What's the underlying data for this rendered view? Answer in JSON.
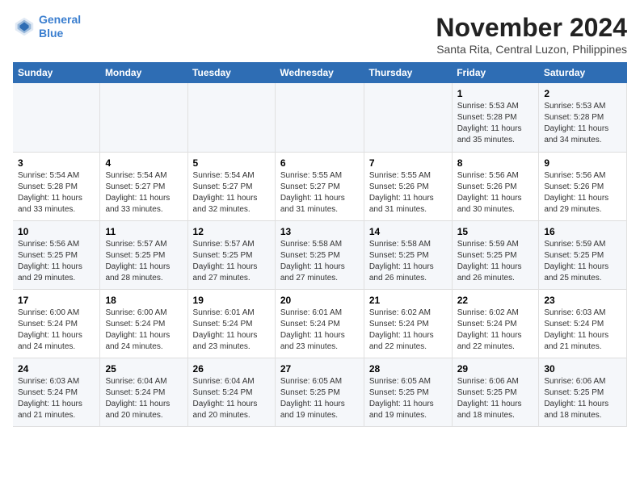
{
  "logo": {
    "line1": "General",
    "line2": "Blue"
  },
  "title": "November 2024",
  "subtitle": "Santa Rita, Central Luzon, Philippines",
  "days_header": [
    "Sunday",
    "Monday",
    "Tuesday",
    "Wednesday",
    "Thursday",
    "Friday",
    "Saturday"
  ],
  "weeks": [
    [
      {
        "day": "",
        "info": ""
      },
      {
        "day": "",
        "info": ""
      },
      {
        "day": "",
        "info": ""
      },
      {
        "day": "",
        "info": ""
      },
      {
        "day": "",
        "info": ""
      },
      {
        "day": "1",
        "info": "Sunrise: 5:53 AM\nSunset: 5:28 PM\nDaylight: 11 hours and 35 minutes."
      },
      {
        "day": "2",
        "info": "Sunrise: 5:53 AM\nSunset: 5:28 PM\nDaylight: 11 hours and 34 minutes."
      }
    ],
    [
      {
        "day": "3",
        "info": "Sunrise: 5:54 AM\nSunset: 5:28 PM\nDaylight: 11 hours and 33 minutes."
      },
      {
        "day": "4",
        "info": "Sunrise: 5:54 AM\nSunset: 5:27 PM\nDaylight: 11 hours and 33 minutes."
      },
      {
        "day": "5",
        "info": "Sunrise: 5:54 AM\nSunset: 5:27 PM\nDaylight: 11 hours and 32 minutes."
      },
      {
        "day": "6",
        "info": "Sunrise: 5:55 AM\nSunset: 5:27 PM\nDaylight: 11 hours and 31 minutes."
      },
      {
        "day": "7",
        "info": "Sunrise: 5:55 AM\nSunset: 5:26 PM\nDaylight: 11 hours and 31 minutes."
      },
      {
        "day": "8",
        "info": "Sunrise: 5:56 AM\nSunset: 5:26 PM\nDaylight: 11 hours and 30 minutes."
      },
      {
        "day": "9",
        "info": "Sunrise: 5:56 AM\nSunset: 5:26 PM\nDaylight: 11 hours and 29 minutes."
      }
    ],
    [
      {
        "day": "10",
        "info": "Sunrise: 5:56 AM\nSunset: 5:25 PM\nDaylight: 11 hours and 29 minutes."
      },
      {
        "day": "11",
        "info": "Sunrise: 5:57 AM\nSunset: 5:25 PM\nDaylight: 11 hours and 28 minutes."
      },
      {
        "day": "12",
        "info": "Sunrise: 5:57 AM\nSunset: 5:25 PM\nDaylight: 11 hours and 27 minutes."
      },
      {
        "day": "13",
        "info": "Sunrise: 5:58 AM\nSunset: 5:25 PM\nDaylight: 11 hours and 27 minutes."
      },
      {
        "day": "14",
        "info": "Sunrise: 5:58 AM\nSunset: 5:25 PM\nDaylight: 11 hours and 26 minutes."
      },
      {
        "day": "15",
        "info": "Sunrise: 5:59 AM\nSunset: 5:25 PM\nDaylight: 11 hours and 26 minutes."
      },
      {
        "day": "16",
        "info": "Sunrise: 5:59 AM\nSunset: 5:25 PM\nDaylight: 11 hours and 25 minutes."
      }
    ],
    [
      {
        "day": "17",
        "info": "Sunrise: 6:00 AM\nSunset: 5:24 PM\nDaylight: 11 hours and 24 minutes."
      },
      {
        "day": "18",
        "info": "Sunrise: 6:00 AM\nSunset: 5:24 PM\nDaylight: 11 hours and 24 minutes."
      },
      {
        "day": "19",
        "info": "Sunrise: 6:01 AM\nSunset: 5:24 PM\nDaylight: 11 hours and 23 minutes."
      },
      {
        "day": "20",
        "info": "Sunrise: 6:01 AM\nSunset: 5:24 PM\nDaylight: 11 hours and 23 minutes."
      },
      {
        "day": "21",
        "info": "Sunrise: 6:02 AM\nSunset: 5:24 PM\nDaylight: 11 hours and 22 minutes."
      },
      {
        "day": "22",
        "info": "Sunrise: 6:02 AM\nSunset: 5:24 PM\nDaylight: 11 hours and 22 minutes."
      },
      {
        "day": "23",
        "info": "Sunrise: 6:03 AM\nSunset: 5:24 PM\nDaylight: 11 hours and 21 minutes."
      }
    ],
    [
      {
        "day": "24",
        "info": "Sunrise: 6:03 AM\nSunset: 5:24 PM\nDaylight: 11 hours and 21 minutes."
      },
      {
        "day": "25",
        "info": "Sunrise: 6:04 AM\nSunset: 5:24 PM\nDaylight: 11 hours and 20 minutes."
      },
      {
        "day": "26",
        "info": "Sunrise: 6:04 AM\nSunset: 5:24 PM\nDaylight: 11 hours and 20 minutes."
      },
      {
        "day": "27",
        "info": "Sunrise: 6:05 AM\nSunset: 5:25 PM\nDaylight: 11 hours and 19 minutes."
      },
      {
        "day": "28",
        "info": "Sunrise: 6:05 AM\nSunset: 5:25 PM\nDaylight: 11 hours and 19 minutes."
      },
      {
        "day": "29",
        "info": "Sunrise: 6:06 AM\nSunset: 5:25 PM\nDaylight: 11 hours and 18 minutes."
      },
      {
        "day": "30",
        "info": "Sunrise: 6:06 AM\nSunset: 5:25 PM\nDaylight: 11 hours and 18 minutes."
      }
    ]
  ]
}
